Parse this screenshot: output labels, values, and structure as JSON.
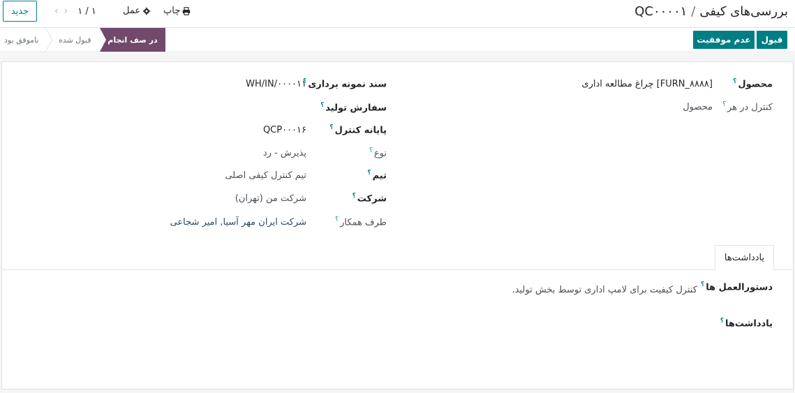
{
  "header": {
    "breadcrumb_parent": "بررسی‌های کیفی",
    "breadcrumb_separator": "/",
    "record_name": "QC۰۰۰۰۱",
    "new_label": "جدید",
    "pager_value": "۱ / ۱",
    "print_label": "چاپ",
    "action_label": "عمل",
    "print_icon": "printer-icon",
    "action_icon": "gear-icon",
    "brand_color": "#017e84"
  },
  "statusbar": {
    "accept_label": "قبول",
    "fail_label": "عدم موفقیت",
    "stages": {
      "active": "در صف انجام",
      "accepted": "قبول شده",
      "failed": "ناموفق بود"
    },
    "active_color": "#71496a"
  },
  "form": {
    "product_label": "محصول",
    "product_value": "[FURN_۸۸۸۸] چراغ مطالعه اداری",
    "control_per_label": "کنترل در هر",
    "control_per_value": "محصول",
    "picking_label": "سند نمونه برداری",
    "picking_value": "WH/IN/۰۰۰۰۱۱",
    "production_label": "سفارش تولید",
    "control_point_label": "پایانه کنترل",
    "control_point_value": "QCP۰۰۰۱۶",
    "type_label": "نوع",
    "type_value": "پذیرش - رد",
    "team_label": "تیم",
    "team_value": "تیم کنترل کیفی اصلی",
    "company_label": "شرکت",
    "company_value": "شرکت من (تهران)",
    "partner_label": "طرف همکار",
    "partner_value": "شرکت ایران مهر آسیا, امیر شجاعی",
    "help_mark": "؟"
  },
  "tabs": {
    "notes_tab": "یادداشت‌ها"
  },
  "notes": {
    "instructions_label": "دستورالعمل ها",
    "instructions_value": "کنترل کیفیت برای لامپ اداری توسط بخش تولید.",
    "notes_label": "یادداشت‌ها"
  }
}
